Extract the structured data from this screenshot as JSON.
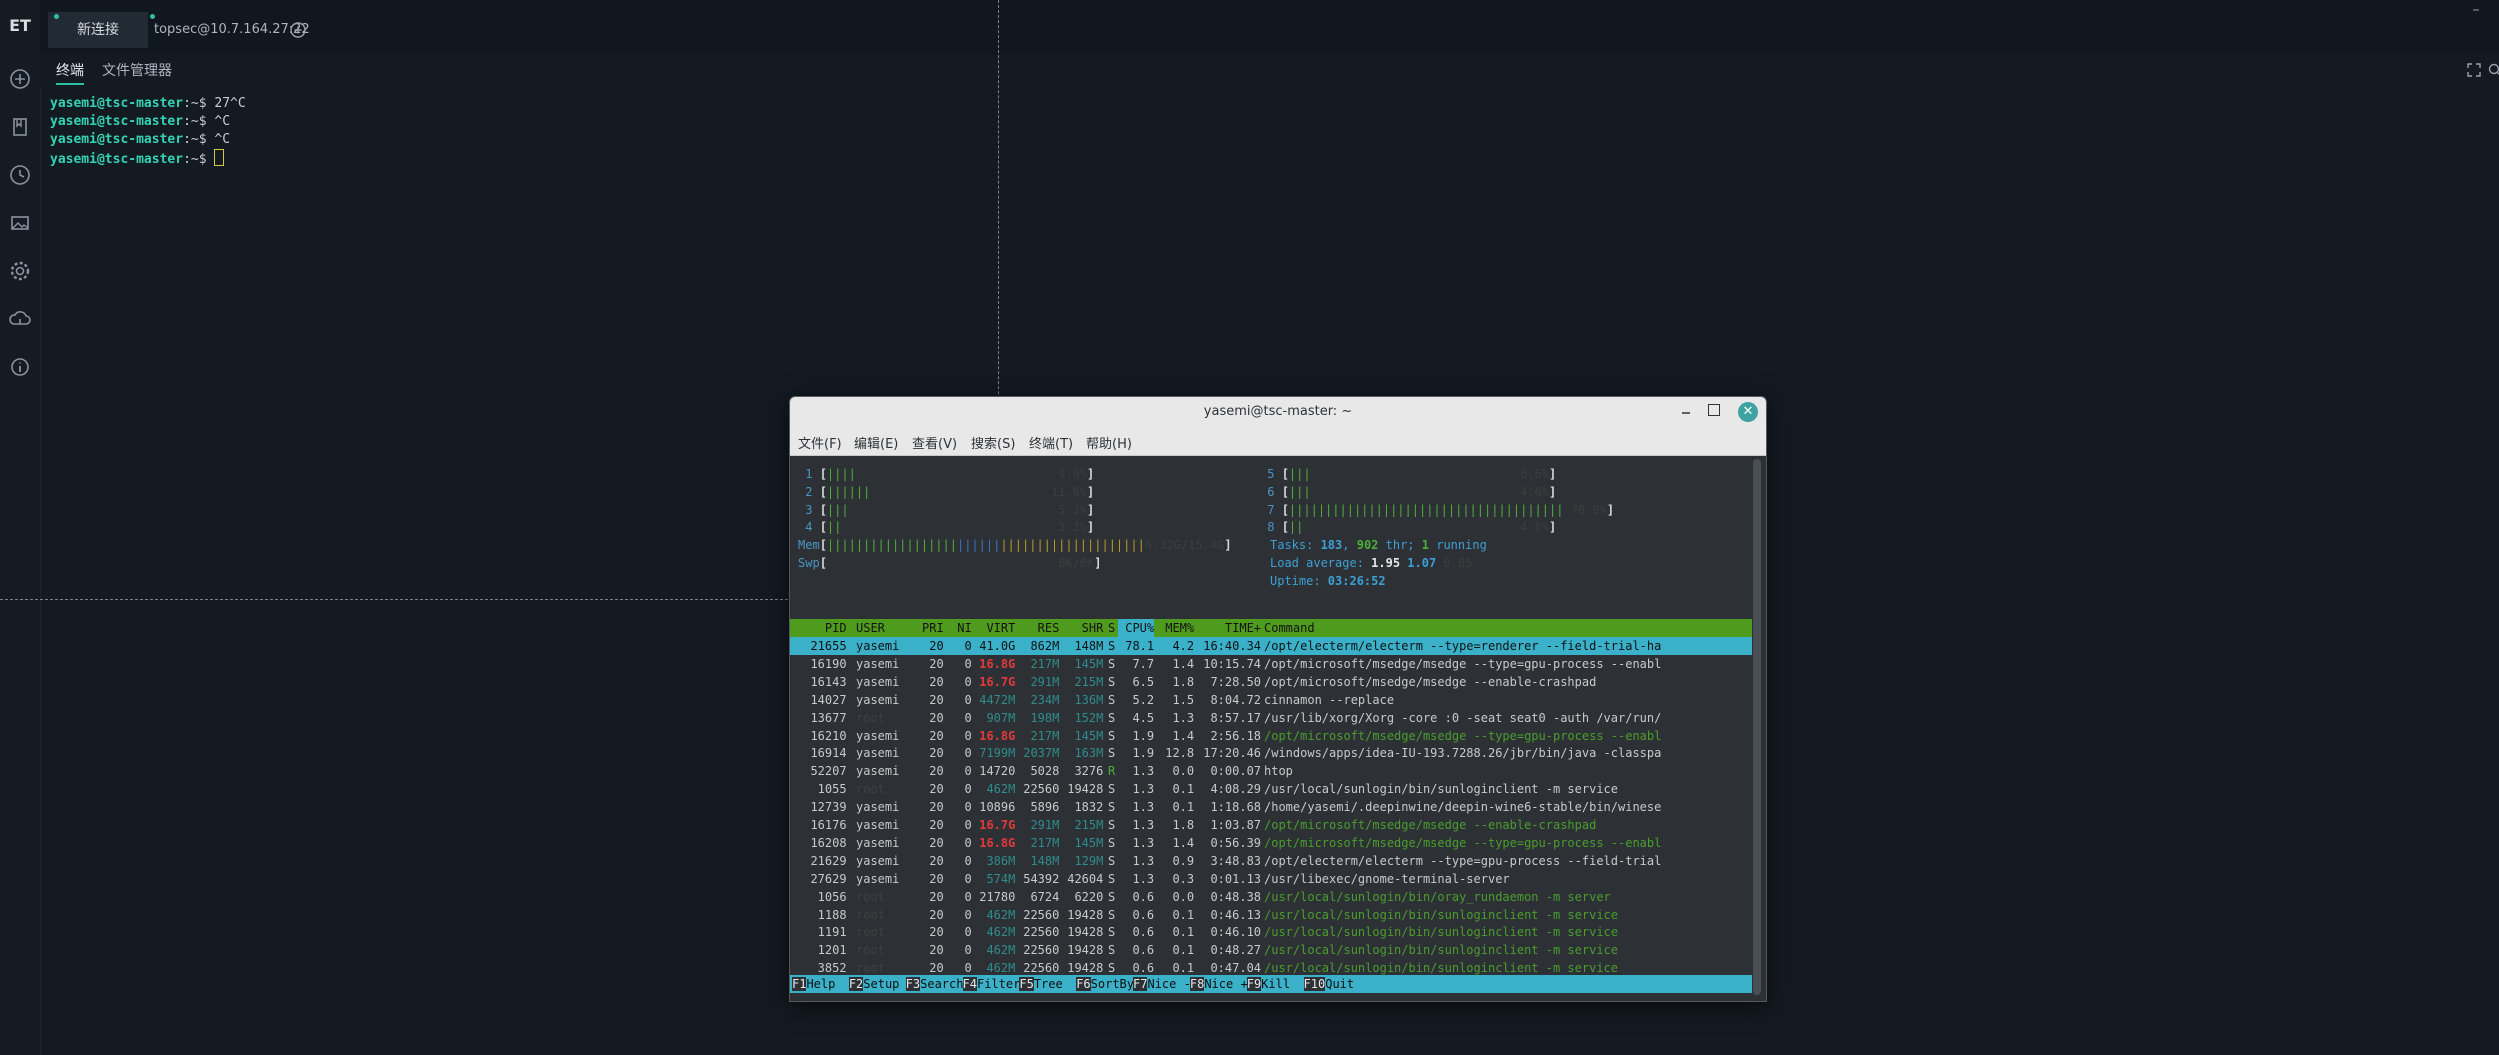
{
  "app": {
    "logo": "ET"
  },
  "tabs": [
    {
      "label": "新连接"
    },
    {
      "label": "topsec@10.7.164.27:22"
    }
  ],
  "window_minimize": "–",
  "subtabs": [
    {
      "label": "终端"
    },
    {
      "label": "文件管理器"
    }
  ],
  "terminal": {
    "lines": [
      {
        "user": "yasemi@tsc-master",
        "rest": ":~$ 27^C"
      },
      {
        "user": "yasemi@tsc-master",
        "rest": ":~$ ^C"
      },
      {
        "user": "yasemi@tsc-master",
        "rest": ":~$ ^C"
      },
      {
        "user": "yasemi@tsc-master",
        "rest": ":~$ "
      }
    ]
  },
  "gnome_window": {
    "title": "yasemi@tsc-master: ~",
    "menu": [
      "文件(F)",
      "编辑(E)",
      "查看(V)",
      "搜索(S)",
      "终端(T)",
      "帮助(H)"
    ]
  },
  "htop": {
    "cpus": [
      {
        "n": "1",
        "bar": "||||",
        "pct": "9.9%"
      },
      {
        "n": "2",
        "bar": "||||||",
        "pct": "11.6%"
      },
      {
        "n": "3",
        "bar": "|||",
        "pct": "5.3%"
      },
      {
        "n": "4",
        "bar": "||",
        "pct": "3.3%"
      },
      {
        "n": "5",
        "bar": "|||",
        "pct": "6.6%"
      },
      {
        "n": "6",
        "bar": "|||",
        "pct": "4.6%"
      },
      {
        "n": "7",
        "bar": "||||||||||||||||||||||||||||||||||||||",
        "pct": "78.9%"
      },
      {
        "n": "8",
        "bar": "||",
        "pct": "4.6%"
      }
    ],
    "mem": {
      "label": "Mem",
      "bar": "||||||||||||||||||||||||||||||||||||||||||||",
      "value": "6.32G/15.4G"
    },
    "swp": {
      "label": "Swp",
      "value": "0K/0K"
    },
    "tasks": {
      "label": "Tasks:",
      "count": "183",
      "thr": "902",
      "thr_label": "thr;",
      "running": "1",
      "running_label": "running"
    },
    "load": {
      "label": "Load average:",
      "v1": "1.95",
      "v2": "1.07",
      "v3": "0.85"
    },
    "uptime": {
      "label": "Uptime:",
      "value": "03:26:52"
    },
    "columns": [
      "PID",
      "USER",
      "PRI",
      "NI",
      "VIRT",
      "RES",
      "SHR",
      "S",
      "CPU%",
      "MEM%",
      "TIME+",
      "Command"
    ],
    "rows": [
      {
        "pid": "21655",
        "user": "yasemi",
        "pri": "20",
        "ni": "0",
        "virt": "41.0G",
        "res": "862M",
        "shr": "148M",
        "s": "S",
        "cpu": "78.1",
        "mem": "4.2",
        "time": "16:40.34",
        "cmd": "/opt/electerm/electerm --type=renderer --field-trial-ha"
      },
      {
        "pid": "16190",
        "user": "yasemi",
        "pri": "20",
        "ni": "0",
        "virt": "16.8G",
        "res": "217M",
        "shr": "145M",
        "s": "S",
        "cpu": "7.7",
        "mem": "1.4",
        "time": "10:15.74",
        "cmd": "/opt/microsoft/msedge/msedge --type=gpu-process --enabl"
      },
      {
        "pid": "16143",
        "user": "yasemi",
        "pri": "20",
        "ni": "0",
        "virt": "16.7G",
        "res": "291M",
        "shr": "215M",
        "s": "S",
        "cpu": "6.5",
        "mem": "1.8",
        "time": "7:28.50",
        "cmd": "/opt/microsoft/msedge/msedge --enable-crashpad"
      },
      {
        "pid": "14027",
        "user": "yasemi",
        "pri": "20",
        "ni": "0",
        "virt": "4472M",
        "res": "234M",
        "shr": "136M",
        "s": "S",
        "cpu": "5.2",
        "mem": "1.5",
        "time": "8:04.72",
        "cmd": "cinnamon --replace"
      },
      {
        "pid": "13677",
        "user": "root",
        "pri": "20",
        "ni": "0",
        "virt": "907M",
        "res": "198M",
        "shr": "152M",
        "s": "S",
        "cpu": "4.5",
        "mem": "1.3",
        "time": "8:57.17",
        "cmd": "/usr/lib/xorg/Xorg -core :0 -seat seat0 -auth /var/run/"
      },
      {
        "pid": "16210",
        "user": "yasemi",
        "pri": "20",
        "ni": "0",
        "virt": "16.8G",
        "res": "217M",
        "shr": "145M",
        "s": "S",
        "cpu": "1.9",
        "mem": "1.4",
        "time": "2:56.18",
        "cmd": "/opt/microsoft/msedge/msedge --type=gpu-process --enabl"
      },
      {
        "pid": "16914",
        "user": "yasemi",
        "pri": "20",
        "ni": "0",
        "virt": "7199M",
        "res": "2037M",
        "shr": "163M",
        "s": "S",
        "cpu": "1.9",
        "mem": "12.8",
        "time": "17:20.46",
        "cmd": "/windows/apps/idea-IU-193.7288.26/jbr/bin/java -classpa"
      },
      {
        "pid": "52207",
        "user": "yasemi",
        "pri": "20",
        "ni": "0",
        "virt": "14720",
        "res": "5028",
        "shr": "3276",
        "s": "R",
        "cpu": "1.3",
        "mem": "0.0",
        "time": "0:00.07",
        "cmd": "htop"
      },
      {
        "pid": "1055",
        "user": "root",
        "pri": "20",
        "ni": "0",
        "virt": "462M",
        "res": "22560",
        "shr": "19428",
        "s": "S",
        "cpu": "1.3",
        "mem": "0.1",
        "time": "4:08.29",
        "cmd": "/usr/local/sunlogin/bin/sunloginclient -m service"
      },
      {
        "pid": "12739",
        "user": "yasemi",
        "pri": "20",
        "ni": "0",
        "virt": "10896",
        "res": "5896",
        "shr": "1832",
        "s": "S",
        "cpu": "1.3",
        "mem": "0.1",
        "time": "1:18.68",
        "cmd": "/home/yasemi/.deepinwine/deepin-wine6-stable/bin/winese"
      },
      {
        "pid": "16176",
        "user": "yasemi",
        "pri": "20",
        "ni": "0",
        "virt": "16.7G",
        "res": "291M",
        "shr": "215M",
        "s": "S",
        "cpu": "1.3",
        "mem": "1.8",
        "time": "1:03.87",
        "cmd": "/opt/microsoft/msedge/msedge --enable-crashpad"
      },
      {
        "pid": "16208",
        "user": "yasemi",
        "pri": "20",
        "ni": "0",
        "virt": "16.8G",
        "res": "217M",
        "shr": "145M",
        "s": "S",
        "cpu": "1.3",
        "mem": "1.4",
        "time": "0:56.39",
        "cmd": "/opt/microsoft/msedge/msedge --type=gpu-process --enabl"
      },
      {
        "pid": "21629",
        "user": "yasemi",
        "pri": "20",
        "ni": "0",
        "virt": "386M",
        "res": "148M",
        "shr": "129M",
        "s": "S",
        "cpu": "1.3",
        "mem": "0.9",
        "time": "3:48.83",
        "cmd": "/opt/electerm/electerm --type=gpu-process --field-trial"
      },
      {
        "pid": "27629",
        "user": "yasemi",
        "pri": "20",
        "ni": "0",
        "virt": "574M",
        "res": "54392",
        "shr": "42604",
        "s": "S",
        "cpu": "1.3",
        "mem": "0.3",
        "time": "0:01.13",
        "cmd": "/usr/libexec/gnome-terminal-server"
      },
      {
        "pid": "1056",
        "user": "root",
        "pri": "20",
        "ni": "0",
        "virt": "21780",
        "res": "6724",
        "shr": "6220",
        "s": "S",
        "cpu": "0.6",
        "mem": "0.0",
        "time": "0:48.38",
        "cmd": "/usr/local/sunlogin/bin/oray_rundaemon -m server"
      },
      {
        "pid": "1188",
        "user": "root",
        "pri": "20",
        "ni": "0",
        "virt": "462M",
        "res": "22560",
        "shr": "19428",
        "s": "S",
        "cpu": "0.6",
        "mem": "0.1",
        "time": "0:46.13",
        "cmd": "/usr/local/sunlogin/bin/sunloginclient -m service"
      },
      {
        "pid": "1191",
        "user": "root",
        "pri": "20",
        "ni": "0",
        "virt": "462M",
        "res": "22560",
        "shr": "19428",
        "s": "S",
        "cpu": "0.6",
        "mem": "0.1",
        "time": "0:46.10",
        "cmd": "/usr/local/sunlogin/bin/sunloginclient -m service"
      },
      {
        "pid": "1201",
        "user": "root",
        "pri": "20",
        "ni": "0",
        "virt": "462M",
        "res": "22560",
        "shr": "19428",
        "s": "S",
        "cpu": "0.6",
        "mem": "0.1",
        "time": "0:48.27",
        "cmd": "/usr/local/sunlogin/bin/sunloginclient -m service"
      },
      {
        "pid": "3852",
        "user": "root",
        "pri": "20",
        "ni": "0",
        "virt": "462M",
        "res": "22560",
        "shr": "19428",
        "s": "S",
        "cpu": "0.6",
        "mem": "0.1",
        "time": "0:47.04",
        "cmd": "/usr/local/sunlogin/bin/sunloginclient -m service"
      }
    ],
    "fkeys": [
      {
        "k": "F1",
        "l": "Help"
      },
      {
        "k": "F2",
        "l": "Setup"
      },
      {
        "k": "F3",
        "l": "Search"
      },
      {
        "k": "F4",
        "l": "Filter"
      },
      {
        "k": "F5",
        "l": "Tree"
      },
      {
        "k": "F6",
        "l": "SortBy"
      },
      {
        "k": "F7",
        "l": "Nice -"
      },
      {
        "k": "F8",
        "l": "Nice +"
      },
      {
        "k": "F9",
        "l": "Kill"
      },
      {
        "k": "F10",
        "l": "Quit"
      }
    ]
  },
  "colors": {
    "accent": "#2fbfa4",
    "htop_header": "#4f9b1e",
    "htop_selected": "#3bb0c9"
  }
}
